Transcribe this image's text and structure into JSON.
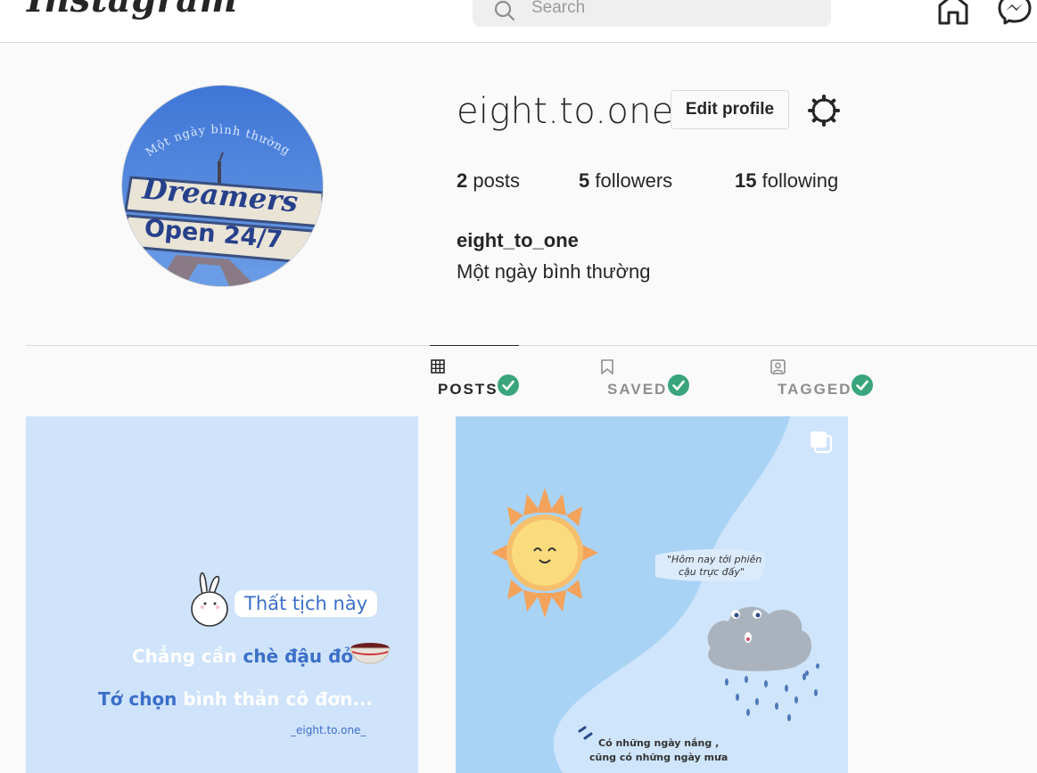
{
  "nav": {
    "logo": "Instagram",
    "search_placeholder": "Search"
  },
  "profile": {
    "username": "eight.to.one",
    "edit_profile_label": "Edit profile",
    "stats": {
      "posts_count": "2",
      "posts_label": "posts",
      "followers_count": "5",
      "followers_label": "followers",
      "following_count": "15",
      "following_label": "following"
    },
    "full_name": "eight_to_one",
    "bio": "Một ngày bình thường",
    "avatar": {
      "arc_text": "Một ngày bình thường",
      "sign_top": "Dreamers",
      "sign_bottom": "Open 24/7"
    }
  },
  "tabs": [
    {
      "label": "POSTS",
      "active": true
    },
    {
      "label": "SAVED",
      "active": false
    },
    {
      "label": "TAGGED",
      "active": false
    }
  ],
  "posts": [
    {
      "line1": "Thất tịch này",
      "line2a": "Chẳng cần ",
      "line2b": "chè đậu đỏ",
      "line3a": "Tớ chọn ",
      "line3b": "bình thản cô đơn...",
      "signature": "_eight.to.one_"
    },
    {
      "bubble_line1": "\"Hôm nay tới phiên",
      "bubble_line2": "cậu trực đấy\"",
      "caption_line1": "Có những ngày nắng ,",
      "caption_line2": "cũng có những ngày mưa"
    }
  ],
  "colors": {
    "check_green": "#3aa57d",
    "post1_bg": "#cfe3fb",
    "post2_bg": "#a9d3f5"
  }
}
